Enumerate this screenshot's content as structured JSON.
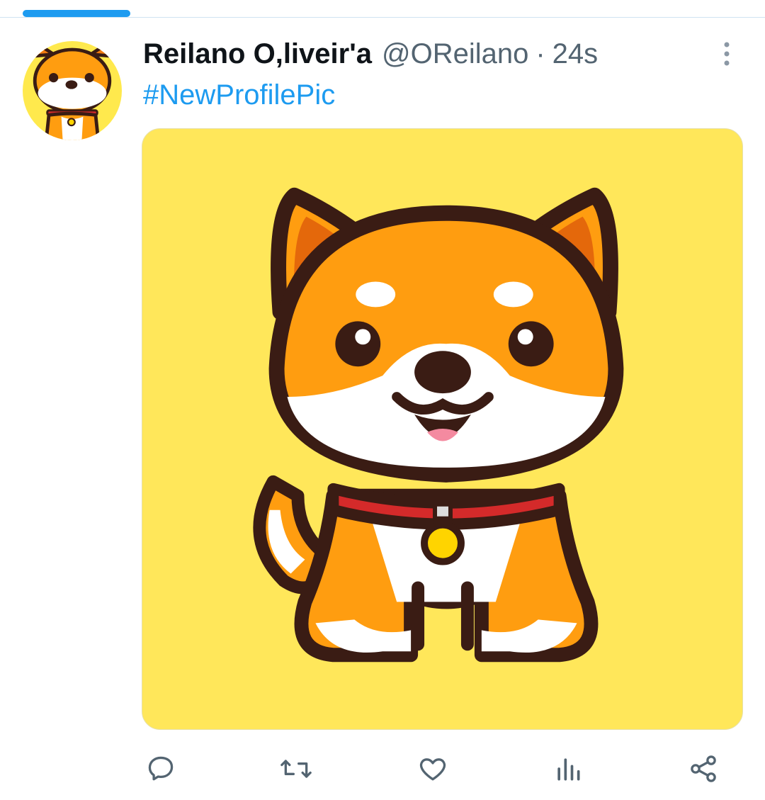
{
  "tweet": {
    "author_name": "Reilano O,liveir'a",
    "handle": "@OReilano",
    "separator": "·",
    "timestamp": "24s",
    "text": "#NewProfilePic"
  },
  "icons": {
    "more": "more-vertical-icon",
    "reply": "reply-icon",
    "retweet": "retweet-icon",
    "like": "heart-icon",
    "views": "analytics-icon",
    "share": "share-icon"
  },
  "colors": {
    "accent": "#1d9bf0",
    "text_primary": "#0f1419",
    "text_secondary": "#536471",
    "media_background": "#ffe75a"
  }
}
